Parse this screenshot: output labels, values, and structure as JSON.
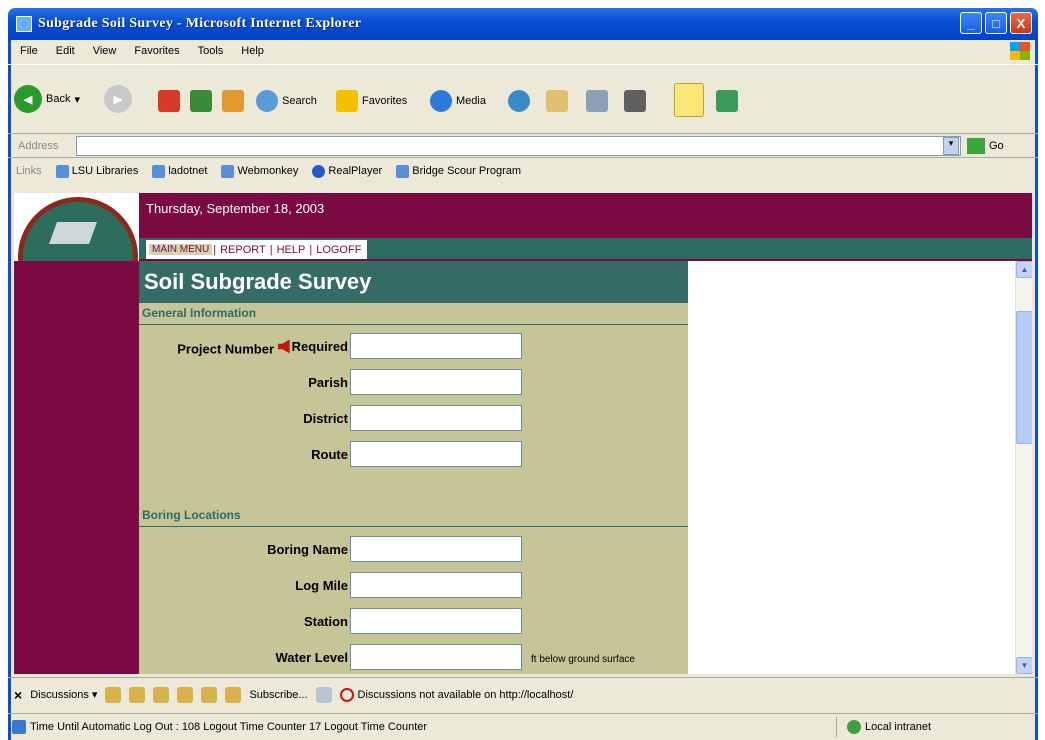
{
  "window": {
    "title": "Subgrade Soil Survey - Microsoft Internet Explorer",
    "min": "_",
    "max": "□",
    "close": "X"
  },
  "menu": [
    "File",
    "Edit",
    "View",
    "Favorites",
    "Tools",
    "Help"
  ],
  "toolbar": {
    "back": "Back",
    "search": "Search",
    "favorites": "Favorites",
    "media": "Media"
  },
  "address": {
    "label": "Address",
    "value": "",
    "go": "Go"
  },
  "links": {
    "label": "Links",
    "items": [
      "LSU Libraries",
      "ladotnet",
      "Webmonkey",
      "RealPlayer",
      "Bridge Scour Program"
    ]
  },
  "page": {
    "date": "Thursday, September 18, 2003",
    "nav": {
      "main": "MAIN MENU",
      "report": "REPORT",
      "help": "HELP",
      "logoff": "LOGOFF",
      "sep": "|"
    },
    "form_title": "Soil Subgrade Survey",
    "general": {
      "heading": "General Information",
      "project_label": "Project Number",
      "required": "Required",
      "parish": "Parish",
      "district": "District",
      "route": "Route"
    },
    "boring": {
      "heading": "Boring Locations",
      "name": "Boring Name",
      "log_mile": "Log Mile",
      "station": "Station",
      "water_level": "Water Level",
      "water_note": "ft below ground surface"
    }
  },
  "discussions": {
    "label": "Discussions ▾",
    "subscribe": "Subscribe...",
    "notice": "Discussions not available on http://localhost/"
  },
  "status": {
    "text": "Time Until Automatic Log Out : 108 Logout Time Counter 17 Logout Time Counter",
    "zone": "Local intranet"
  }
}
